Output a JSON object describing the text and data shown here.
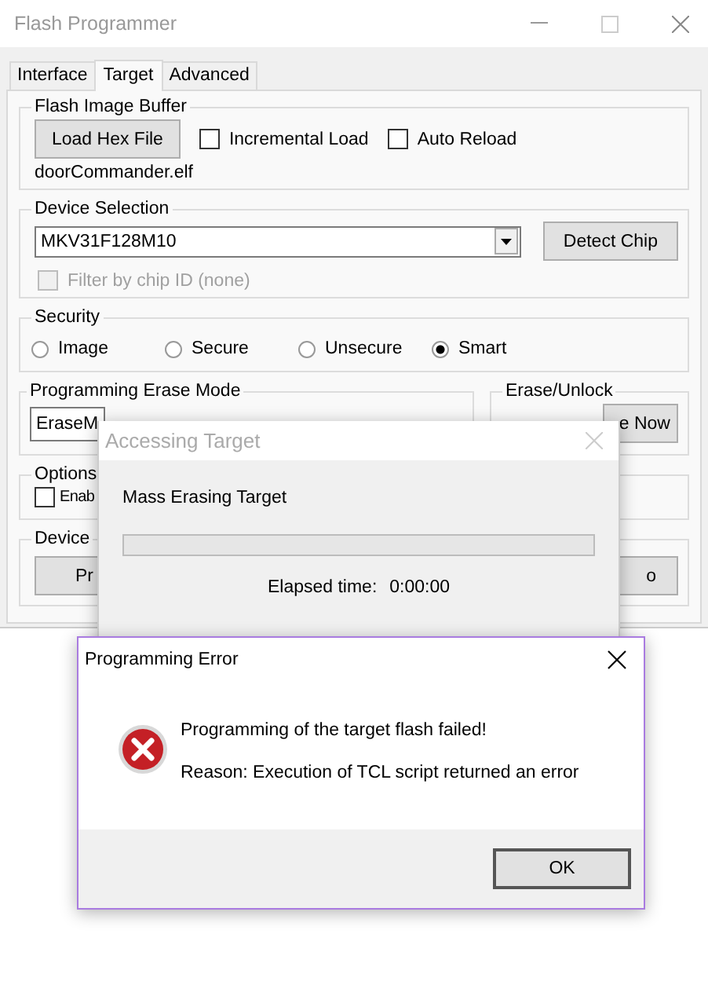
{
  "window": {
    "title": "Flash Programmer"
  },
  "tabs": [
    {
      "label": "Interface",
      "selected": false
    },
    {
      "label": "Target",
      "selected": true
    },
    {
      "label": "Advanced",
      "selected": false
    }
  ],
  "flash_image_buffer": {
    "title": "Flash Image Buffer",
    "load_button": "Load Hex File",
    "options": [
      {
        "label": "Incremental Load",
        "checked": false
      },
      {
        "label": "Auto Reload",
        "checked": false
      }
    ],
    "file": "doorCommander.elf"
  },
  "device_selection": {
    "title": "Device Selection",
    "device": "MKV31F128M10",
    "detect_button": "Detect Chip",
    "filter": {
      "label": "Filter by chip ID (none)",
      "checked": false,
      "disabled": true
    }
  },
  "security": {
    "title": "Security",
    "options": [
      {
        "label": "Image",
        "selected": false
      },
      {
        "label": "Secure",
        "selected": false
      },
      {
        "label": "Unsecure",
        "selected": false
      },
      {
        "label": "Smart",
        "selected": true
      }
    ]
  },
  "erase_mode": {
    "title": "Programming Erase Mode",
    "value": "EraseM"
  },
  "erase_unlock": {
    "title": "Erase/Unlock",
    "button": "e Now"
  },
  "options": {
    "title": "Options",
    "checkbox": {
      "label": "Enab",
      "checked": false
    }
  },
  "device_group": {
    "title": "Device",
    "buttons": [
      "Pr",
      "o"
    ]
  },
  "progress_dialog": {
    "title": "Accessing Target",
    "message": "Mass Erasing Target",
    "level": 0,
    "elapsed_label": "Elapsed time:",
    "elapsed": "0:00:00"
  },
  "error_dialog": {
    "title": "Programming Error",
    "message": "Programming of the target flash failed!",
    "reason": "Reason: Execution of TCL script returned an error",
    "button": "OK"
  }
}
